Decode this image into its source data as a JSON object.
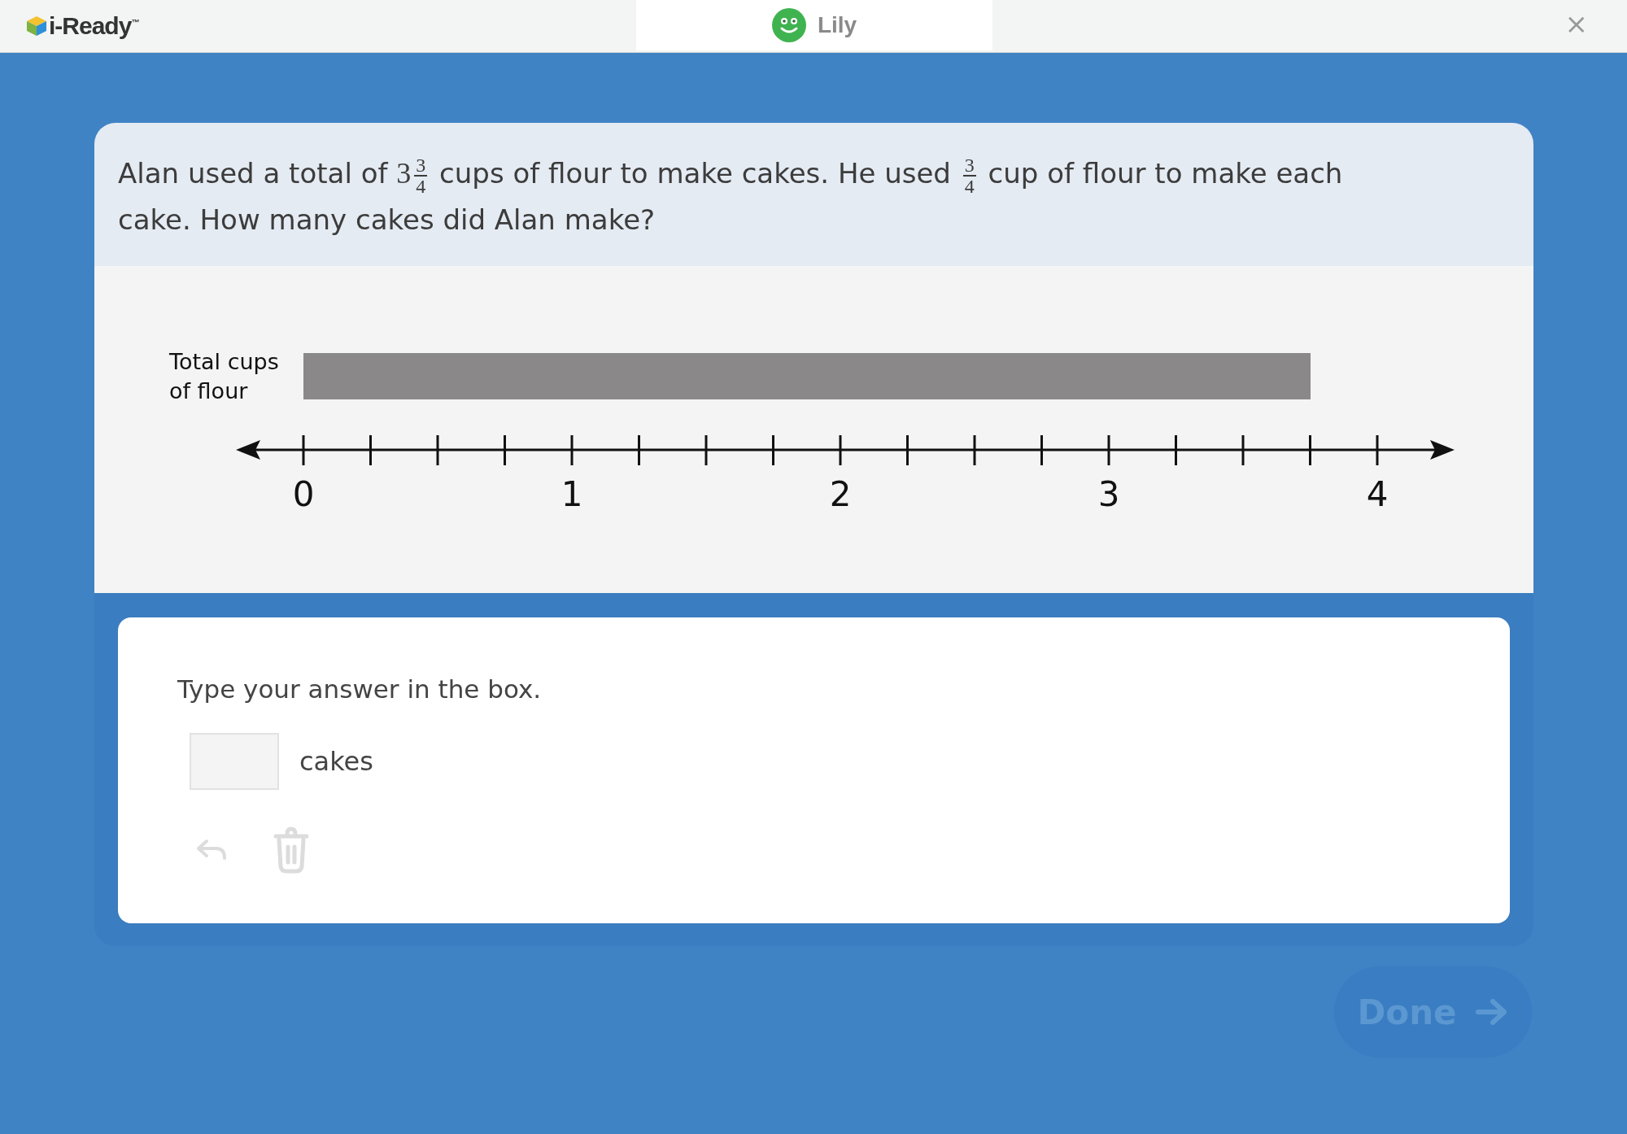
{
  "header": {
    "logo": "i-Ready$^{™}$",
    "student": "Lily",
    "close": "×"
  },
  "question": [
    {
      "kind": "text",
      "text": "Alan used a total of "
    },
    {
      "kind": "mixed",
      "whole": "3",
      "numerator": "3",
      "denominator": "4"
    },
    {
      "kind": "text",
      "text": " cups of flour to make cakes. He used "
    },
    {
      "kind": "fraction",
      "numerator": "3",
      "denominator": "4"
    },
    {
      "kind": "text",
      "text": " cup of flour to make each cake. How many cakes did Alan make?"
    }
  ],
  "diagram": {
    "bar_label": "Total cups of flour",
    "tick_labels": [
      "0",
      "1",
      "2",
      "3",
      "4"
    ]
  },
  "answer": {
    "prompt": "Type your answer in the box.",
    "unit": "cakes",
    "undo_disabled": true,
    "delete_disabled": true
  },
  "done_button": {
    "label": "Done",
    "disabled": true
  }
}
